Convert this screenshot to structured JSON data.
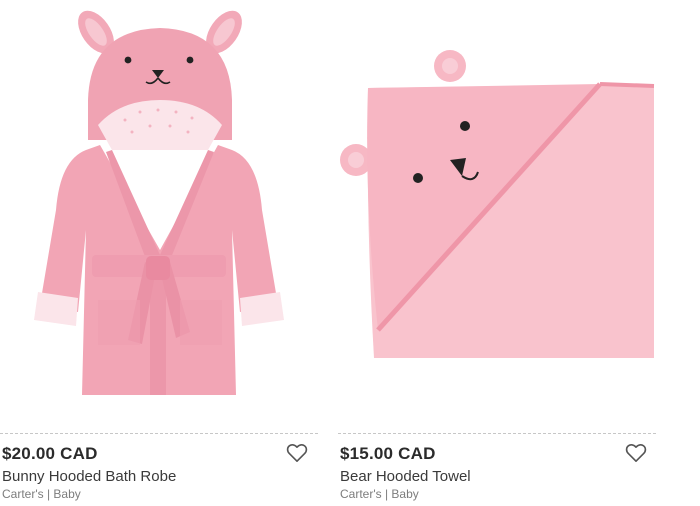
{
  "products": [
    {
      "price": "$20.00 CAD",
      "name": "Bunny Hooded Bath Robe",
      "brand": "Carter's | Baby",
      "icon": "heart-outline-icon",
      "color": "#f2a9b8"
    },
    {
      "price": "$15.00 CAD",
      "name": "Bear Hooded Towel",
      "brand": "Carter's | Baby",
      "icon": "heart-outline-icon",
      "color": "#f8bfca"
    }
  ]
}
